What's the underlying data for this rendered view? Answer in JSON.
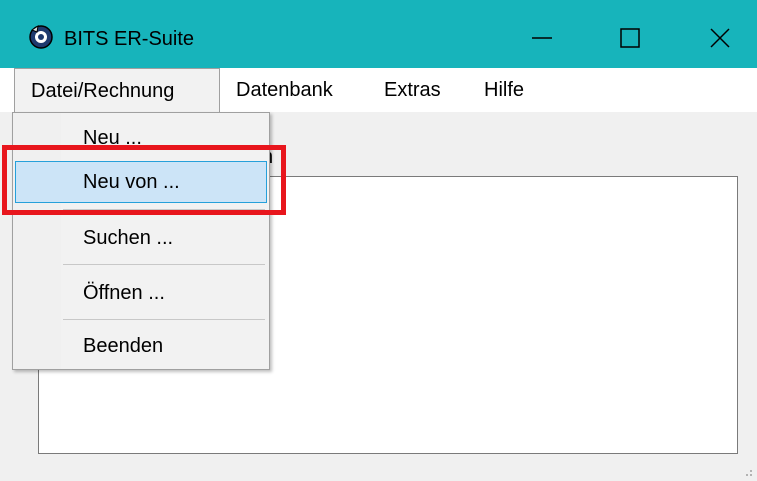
{
  "window": {
    "title": "BITS ER-Suite",
    "icon": "app-icon",
    "controls": [
      "minimize-icon",
      "maximize-icon",
      "close-icon"
    ]
  },
  "menubar": {
    "items": [
      {
        "label": "Datei/Rechnung",
        "open": true
      },
      {
        "label": "Datenbank"
      },
      {
        "label": "Extras"
      },
      {
        "label": "Hilfe"
      }
    ]
  },
  "dropdown": {
    "items": [
      {
        "label": "Neu ..."
      },
      {
        "label": "Neu von ...",
        "selected": true
      },
      {
        "label": "Suchen ..."
      },
      {
        "label": "Öffnen ..."
      },
      {
        "label": "Beenden"
      }
    ]
  },
  "content": {
    "partial_label": "n"
  },
  "colors": {
    "titlebar": "#17b4bb",
    "selection_bg": "#cce4f7",
    "selection_border": "#26a0da",
    "annotation_red": "#e8161d"
  }
}
